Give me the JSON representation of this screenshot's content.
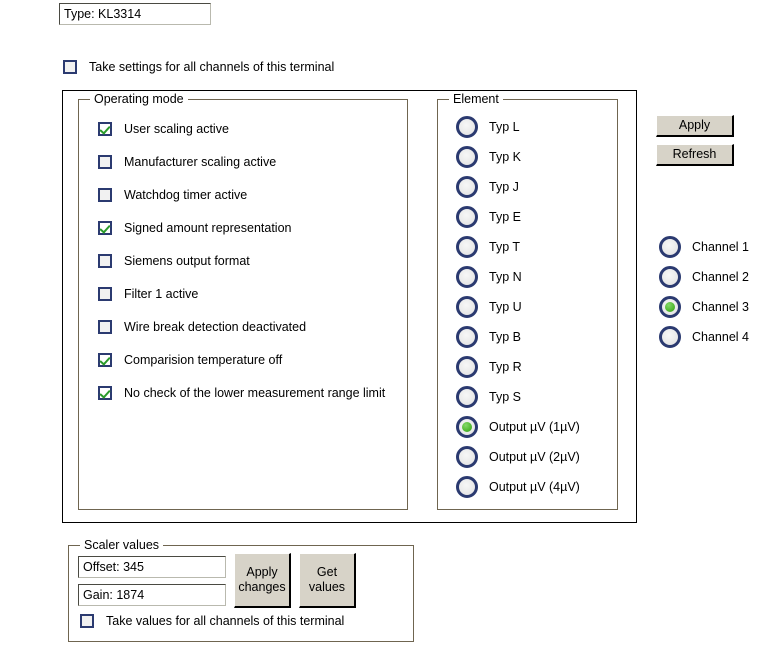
{
  "type_field": {
    "value": "Type: KL3314"
  },
  "take_settings": {
    "label": "Take settings for all channels of this terminal",
    "checked": false
  },
  "operating_mode": {
    "title": "Operating mode",
    "items": [
      {
        "label": "User scaling active",
        "checked": true
      },
      {
        "label": "Manufacturer scaling active",
        "checked": false
      },
      {
        "label": "Watchdog timer active",
        "checked": false
      },
      {
        "label": "Signed amount representation",
        "checked": true
      },
      {
        "label": "Siemens output format",
        "checked": false
      },
      {
        "label": "Filter 1 active",
        "checked": false
      },
      {
        "label": "Wire break detection deactivated",
        "checked": false
      },
      {
        "label": "Comparision temperature off",
        "checked": true
      },
      {
        "label": "No check of the lower measurement range limit",
        "checked": true
      }
    ]
  },
  "element": {
    "title": "Element",
    "items": [
      {
        "label": "Typ L",
        "selected": false
      },
      {
        "label": "Typ K",
        "selected": false
      },
      {
        "label": "Typ J",
        "selected": false
      },
      {
        "label": "Typ E",
        "selected": false
      },
      {
        "label": "Typ T",
        "selected": false
      },
      {
        "label": "Typ N",
        "selected": false
      },
      {
        "label": "Typ U",
        "selected": false
      },
      {
        "label": "Typ B",
        "selected": false
      },
      {
        "label": "Typ R",
        "selected": false
      },
      {
        "label": "Typ S",
        "selected": false
      },
      {
        "label": "Output µV (1µV)",
        "selected": true
      },
      {
        "label": "Output µV (2µV)",
        "selected": false
      },
      {
        "label": "Output µV (4µV)",
        "selected": false
      }
    ]
  },
  "actions": {
    "apply_label": "Apply",
    "refresh_label": "Refresh"
  },
  "channels": {
    "items": [
      {
        "label": "Channel 1",
        "selected": false
      },
      {
        "label": "Channel 2",
        "selected": false
      },
      {
        "label": "Channel 3",
        "selected": true
      },
      {
        "label": "Channel 4",
        "selected": false
      }
    ]
  },
  "scaler_values": {
    "title": "Scaler values",
    "offset_value": "Offset: 345",
    "gain_value": "Gain: 1874",
    "apply_changes_line1": "Apply",
    "apply_changes_line2": "changes",
    "get_values_line1": "Get",
    "get_values_line2": "values",
    "take_values": {
      "label": "Take values for all channels of this terminal",
      "checked": false
    }
  },
  "colors": {
    "control_border": "#2b3a70",
    "check_green": "#2a9b2a",
    "radio_green": "#4fb82e",
    "group_border": "#6f6550",
    "button_face": "#d7d3c8",
    "panel_border": "#000000"
  }
}
